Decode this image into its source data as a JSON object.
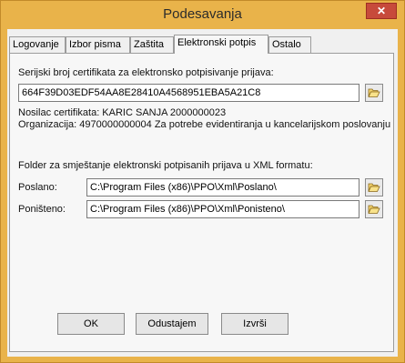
{
  "window": {
    "title": "Podesavanja",
    "close_glyph": "✕"
  },
  "tabs": [
    {
      "label": "Logovanje"
    },
    {
      "label": "Izbor pisma"
    },
    {
      "label": "Zaštita"
    },
    {
      "label": "Elektronski potpis"
    },
    {
      "label": "Ostalo"
    }
  ],
  "active_tab": "Elektronski potpis",
  "certificate": {
    "serial_label": "Serijski broj certifikata za elektronsko potpisivanje prijava:",
    "serial_value": "664F39D03EDF54AA8E28410A4568951EBA5A21C8",
    "holder_line": "Nosilac certifikata: KARIC SANJA 2000000023",
    "organization_line": "Organizacija: 4970000000004 Za potrebe evidentiranja u kancelarijskom poslovanju"
  },
  "folders": {
    "heading": "Folder za smještanje elektronski potpisanih prijava u XML formatu:",
    "sent_label": "Poslano:",
    "sent_value": "C:\\Program Files (x86)\\PPO\\Xml\\Poslano\\",
    "cancelled_label": "Poništeno:",
    "cancelled_value": "C:\\Program Files (x86)\\PPO\\Xml\\Ponisteno\\"
  },
  "buttons": {
    "ok": "OK",
    "cancel": "Odustajem",
    "execute": "Izvrši"
  },
  "icons": {
    "folder": "folder-open-icon",
    "close": "close-icon"
  },
  "colors": {
    "title_bar": "#e9b34a",
    "close_button": "#c74a3b",
    "panel_bg": "#f7f7f7"
  }
}
